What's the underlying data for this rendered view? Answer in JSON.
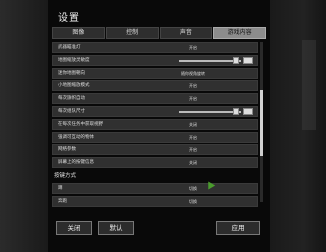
{
  "window": {
    "title": "设置"
  },
  "tabs": [
    {
      "label": "图像",
      "active": false
    },
    {
      "label": "控制",
      "active": false
    },
    {
      "label": "声音",
      "active": false
    },
    {
      "label": "游戏内容",
      "active": true
    }
  ],
  "settings": [
    {
      "label": "武器瞄准灯",
      "value": "开启"
    },
    {
      "label": "地图缩放灵敏度",
      "value": "",
      "slider": true
    },
    {
      "label": "迷你地图朝向",
      "value": "随你视角旋转"
    },
    {
      "label": "小地图缩放模式",
      "value": "开启"
    },
    {
      "label": "每次旗帜自动",
      "value": "开启"
    },
    {
      "label": "每次组队尺寸",
      "value": "",
      "slider": true
    },
    {
      "label": "在每次任务中获取视野",
      "value": "关闭"
    },
    {
      "label": "强调可互动的物体",
      "value": "开启"
    },
    {
      "label": "网络参数",
      "value": "开启"
    },
    {
      "label": "屏幕上的按键信息",
      "value": "关闭"
    }
  ],
  "keybind_section": {
    "heading": "按键方式",
    "rows": [
      {
        "label": "蹲",
        "value": "切换"
      },
      {
        "label": "奔跑",
        "value": "切换"
      }
    ]
  },
  "footer": {
    "close_label": "关闭",
    "default_label": "默认",
    "apply_label": "应用"
  }
}
